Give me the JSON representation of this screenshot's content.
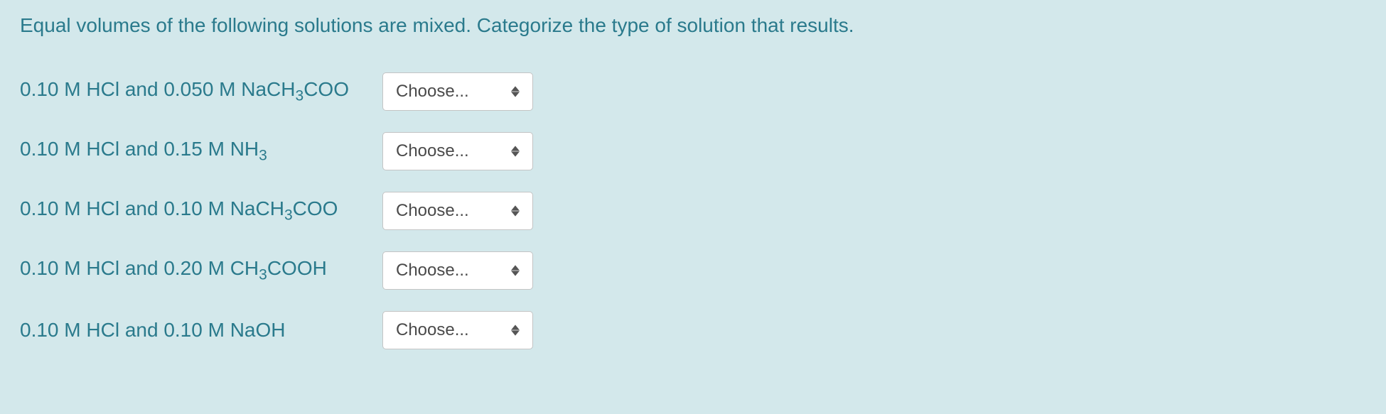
{
  "question": "Equal volumes of the following solutions are mixed. Categorize the type of solution that results.",
  "placeholder": "Choose...",
  "rows": [
    {
      "label": "0.10 M HCl and 0.050 M NaCH<sub>3</sub>COO"
    },
    {
      "label": "0.10 M HCl and 0.15 M NH<sub>3</sub>"
    },
    {
      "label": "0.10 M HCl and 0.10 M NaCH<sub>3</sub>COO"
    },
    {
      "label": "0.10 M HCl and 0.20 M CH<sub>3</sub>COOH"
    },
    {
      "label": "0.10 M HCl and 0.10 M NaOH"
    }
  ]
}
